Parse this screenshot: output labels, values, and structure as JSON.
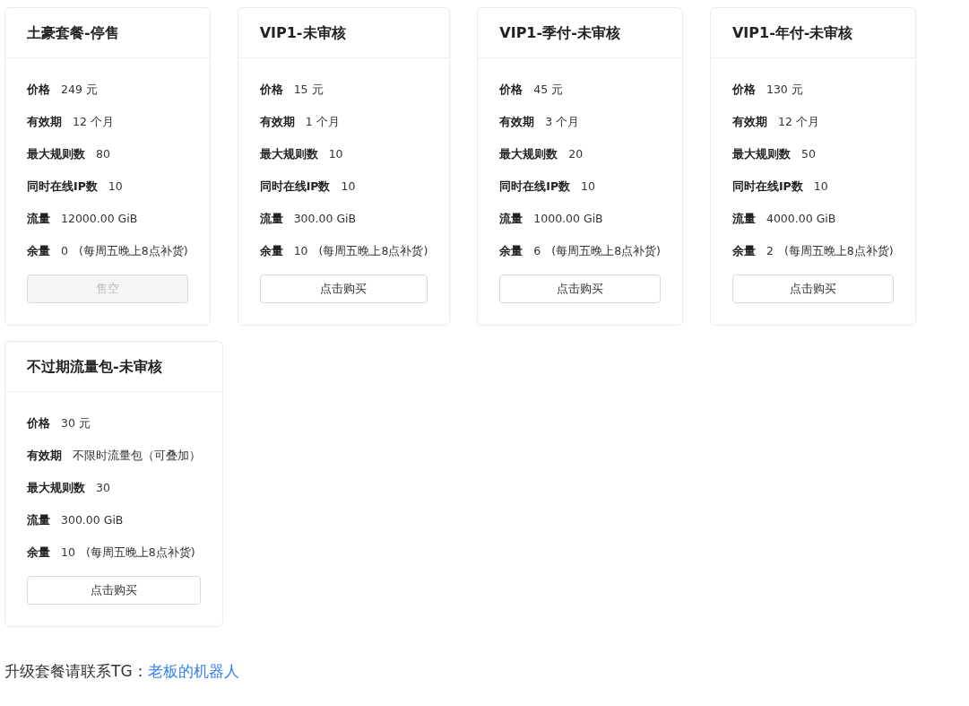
{
  "plans": [
    {
      "title": "土豪套餐-停售",
      "fields": [
        {
          "label": "价格",
          "value": "249 元"
        },
        {
          "label": "有效期",
          "value": "12 个月"
        },
        {
          "label": "最大规则数",
          "value": "80"
        },
        {
          "label": "同时在线IP数",
          "value": "10"
        },
        {
          "label": "流量",
          "value": "12000.00 GiB"
        },
        {
          "label": "余量",
          "value": "0",
          "note": "(每周五晚上8点补货)"
        }
      ],
      "button": {
        "label": "售空",
        "disabled": true
      }
    },
    {
      "title": "VIP1-未审核",
      "fields": [
        {
          "label": "价格",
          "value": "15 元"
        },
        {
          "label": "有效期",
          "value": "1 个月"
        },
        {
          "label": "最大规则数",
          "value": "10"
        },
        {
          "label": "同时在线IP数",
          "value": "10"
        },
        {
          "label": "流量",
          "value": "300.00 GiB"
        },
        {
          "label": "余量",
          "value": "10",
          "note": "(每周五晚上8点补货)"
        }
      ],
      "button": {
        "label": "点击购买",
        "disabled": false
      }
    },
    {
      "title": "VIP1-季付-未审核",
      "fields": [
        {
          "label": "价格",
          "value": "45 元"
        },
        {
          "label": "有效期",
          "value": "3 个月"
        },
        {
          "label": "最大规则数",
          "value": "20"
        },
        {
          "label": "同时在线IP数",
          "value": "10"
        },
        {
          "label": "流量",
          "value": "1000.00 GiB"
        },
        {
          "label": "余量",
          "value": "6",
          "note": "(每周五晚上8点补货)"
        }
      ],
      "button": {
        "label": "点击购买",
        "disabled": false
      }
    },
    {
      "title": "VIP1-年付-未审核",
      "fields": [
        {
          "label": "价格",
          "value": "130 元"
        },
        {
          "label": "有效期",
          "value": "12 个月"
        },
        {
          "label": "最大规则数",
          "value": "50"
        },
        {
          "label": "同时在线IP数",
          "value": "10"
        },
        {
          "label": "流量",
          "value": "4000.00 GiB"
        },
        {
          "label": "余量",
          "value": "2",
          "note": "(每周五晚上8点补货)"
        }
      ],
      "button": {
        "label": "点击购买",
        "disabled": false
      }
    },
    {
      "title": "不过期流量包-未审核",
      "fields": [
        {
          "label": "价格",
          "value": "30 元"
        },
        {
          "label": "有效期",
          "value": "不限时流量包（可叠加）"
        },
        {
          "label": "最大规则数",
          "value": "30"
        },
        {
          "label": "流量",
          "value": "300.00 GiB"
        },
        {
          "label": "余量",
          "value": "10",
          "note": "(每周五晚上8点补货)"
        }
      ],
      "button": {
        "label": "点击购买",
        "disabled": false
      }
    }
  ],
  "footer": {
    "text": "升级套餐请联系TG：",
    "link": "老板的机器人"
  }
}
